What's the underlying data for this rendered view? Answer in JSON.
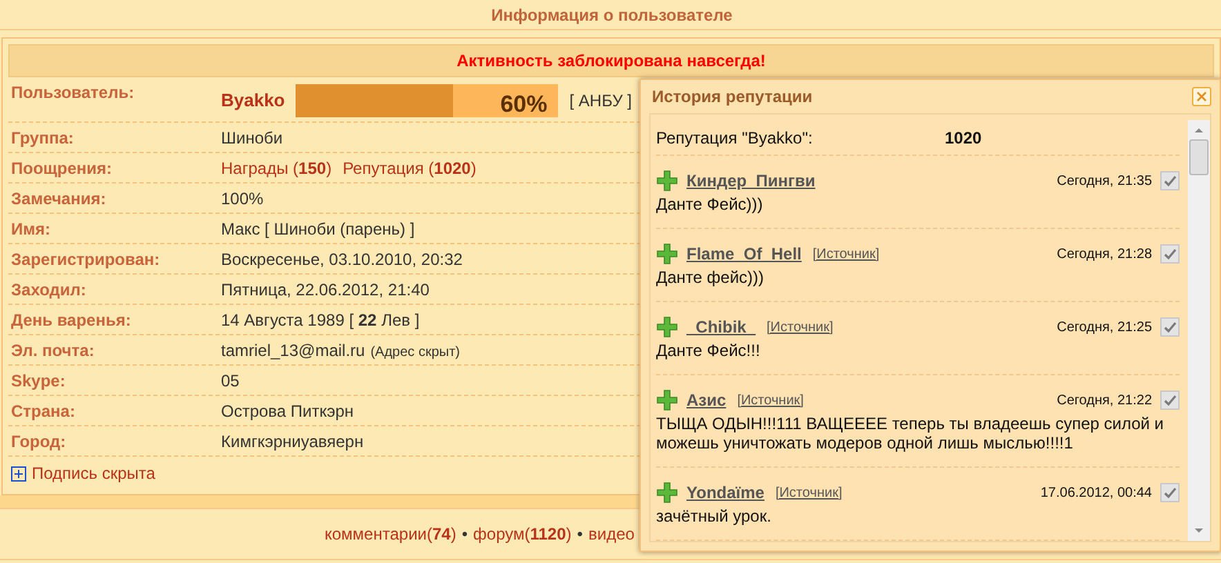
{
  "header": {
    "title": "Информация о пользователе"
  },
  "banner": "Активность заблокирована навсегда!",
  "rows": [
    {
      "label": "Пользователь:",
      "kind": "user",
      "name": "Byakko",
      "level": 0.6,
      "percent": "60%",
      "rank": "[ АНБУ ]"
    },
    {
      "label": "Группа:",
      "kind": "text",
      "value": "Шиноби"
    },
    {
      "label": "Поощрения:",
      "kind": "links",
      "links": [
        "Награды (**150**)",
        "Репутация (**1020**)"
      ]
    },
    {
      "label": "Замечания:",
      "kind": "text",
      "value": "100%"
    },
    {
      "label": "Имя:",
      "kind": "text",
      "value": "Макс [ Шиноби (парень) ]"
    },
    {
      "label": "Зарегистрирован:",
      "kind": "text",
      "value": "Воскресенье, 03.10.2010, 20:32"
    },
    {
      "label": "Заходил:",
      "kind": "text",
      "value": "Пятница, 22.06.2012, 21:40"
    },
    {
      "label": "День варенья:",
      "kind": "text",
      "value": "14 Августа 1989 [ **22** Лев ]"
    },
    {
      "label": "Эл. почта:",
      "kind": "email",
      "value": "tamriel_13@mail.ru",
      "note": "(Адрес скрыт)"
    },
    {
      "label": "Skype:",
      "kind": "text",
      "value": "05"
    },
    {
      "label": "Страна:",
      "kind": "text",
      "value": "Острова Питкэрн"
    },
    {
      "label": "Город:",
      "kind": "text",
      "value": "Кимгкэрниуавяерн"
    }
  ],
  "signature": {
    "label": "Подпись скрыта",
    "expanded": false
  },
  "footer": {
    "separator": "•",
    "links": [
      "комментарии(**74**)",
      "форум(**1120**)",
      "видео"
    ]
  },
  "popup": {
    "title": "История репутации",
    "summary_label": "Репутация \"Byakko\":",
    "summary_value": "1020",
    "entries": [
      {
        "kind": "plus",
        "author": "Киндер_Пингви",
        "time": "Сегодня, 21:35",
        "text": "Данте Фейс)))"
      },
      {
        "kind": "plus",
        "author": "Flame_Of_Hell",
        "source": "[Источник]",
        "time": "Сегодня, 21:28",
        "text": "Данте фейс)))"
      },
      {
        "kind": "plus",
        "author": "_Chibik_",
        "source": "[Источник]",
        "time": "Сегодня, 21:25",
        "text": "Данте Фейс!!!"
      },
      {
        "kind": "plus",
        "author": "Азис",
        "source": "[Источник]",
        "time": "Сегодня, 21:22",
        "text": "ТЫЩА ОДЫН!!!111 ВАЩЕЕЕЕ теперь ты владеешь супер силой и можешь уничтожать модеров одной лишь мыслью!!!!1"
      },
      {
        "kind": "plus",
        "author": "Yondaïme",
        "source": "[Источник]",
        "time": "17.06.2012, 00:44",
        "text": "зачётный урок."
      }
    ]
  }
}
